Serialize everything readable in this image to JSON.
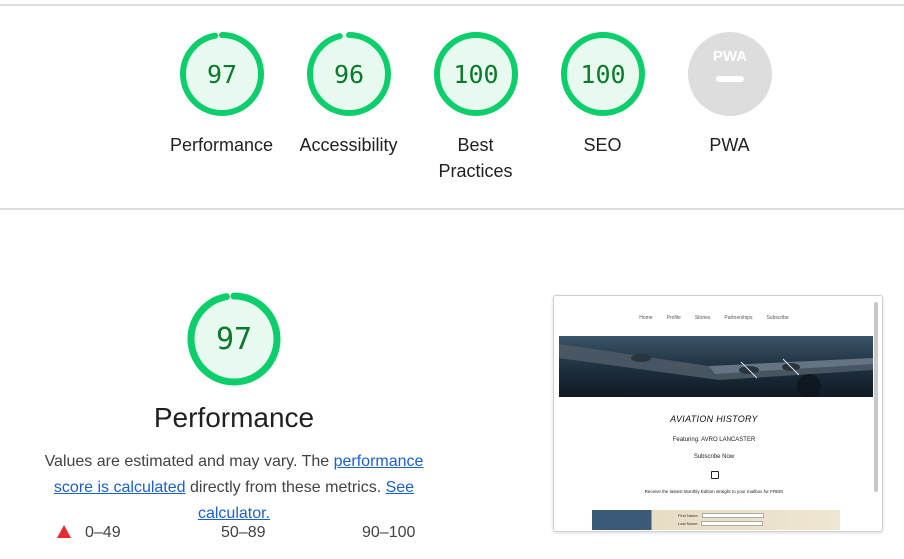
{
  "categories": [
    {
      "label": "Performance",
      "score": 97,
      "fraction": 0.97
    },
    {
      "label": "Accessibility",
      "score": 96,
      "fraction": 0.96
    },
    {
      "label": "Best Practices",
      "label_line1": "Best",
      "label_line2": "Practices",
      "score": 100,
      "fraction": 1.0
    },
    {
      "label": "SEO",
      "score": 100,
      "fraction": 1.0
    },
    {
      "label": "PWA",
      "badge": "PWA"
    }
  ],
  "colors": {
    "pass_stroke": "#0cce6b",
    "pass_fill": "#e8f9ef",
    "pass_text": "#0b7a2a",
    "pwa_bg": "#dddddd",
    "fail": "#eb2b2b",
    "link": "#1a5fd6"
  },
  "performance": {
    "score": 97,
    "fraction": 0.97,
    "title": "Performance",
    "desc_prefix": "Values are estimated and may vary. The ",
    "link_score": "performance score is calculated",
    "desc_middle": " directly from these metrics. ",
    "link_calculator": "See calculator."
  },
  "legend": {
    "fail": "0–49",
    "average": "50–89",
    "pass": "90–100"
  },
  "thumbnail": {
    "nav": [
      "Home",
      "Profile",
      "Stories",
      "Partnerships",
      "Subscribe"
    ],
    "title": "AVIATION HISTORY",
    "featuring": "Featuring: AVRO LANCASTER",
    "subscribe": "Subscribe Now",
    "receive": "Receive the lastest Monthly Edition straight to your mailbox for FREE!",
    "first_name": "First Name:",
    "last_name": "Last Name:"
  }
}
